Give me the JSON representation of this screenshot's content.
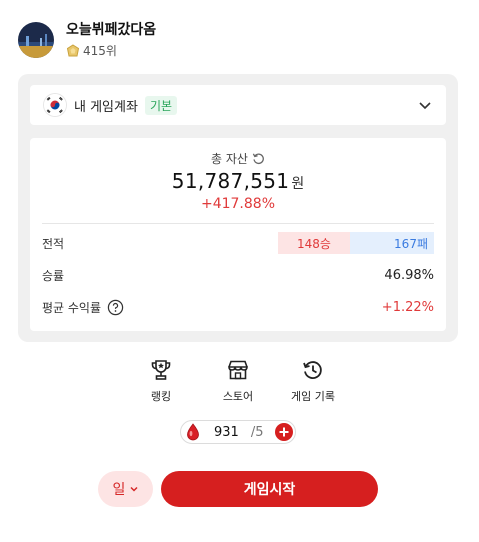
{
  "profile": {
    "name": "오늘뷔페갔다옴",
    "rank": "415위"
  },
  "account": {
    "label": "내 게임계좌",
    "tag": "기본"
  },
  "stats": {
    "total_asset_label": "총 자산",
    "total_asset_value": "51,787,551",
    "total_asset_unit": "원",
    "total_return": "+417.88%",
    "record_label": "전적",
    "wins": "148승",
    "losses": "167패",
    "win_rate_label": "승률",
    "win_rate_value": "46.98%",
    "avg_return_label": "평균 수익률",
    "avg_return_value": "+1.22%"
  },
  "menu": [
    {
      "label": "랭킹",
      "icon": "trophy-icon"
    },
    {
      "label": "스토어",
      "icon": "store-icon"
    },
    {
      "label": "게임 기록",
      "icon": "history-icon"
    }
  ],
  "energy": {
    "current": "931",
    "max": "/5"
  },
  "actions": {
    "mode": "일",
    "start": "게임시작"
  },
  "colors": {
    "accent": "#d61f1f",
    "up": "#e03a3a",
    "down": "#3a7be0",
    "tag_green": "#2aa55a"
  }
}
